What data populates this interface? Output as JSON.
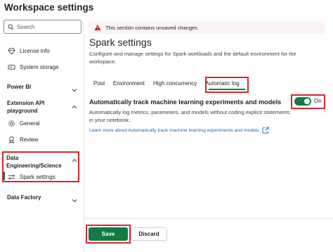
{
  "window": {
    "title": "Workspace settings"
  },
  "search": {
    "placeholder": "Search"
  },
  "sidebar": {
    "items": [
      {
        "label": "License info"
      },
      {
        "label": "System storage"
      }
    ],
    "power_bi": {
      "label": "Power BI"
    },
    "extension_api": {
      "label_line1": "Extension API",
      "label_line2": "playground",
      "items": [
        {
          "label": "General"
        },
        {
          "label": "Review"
        }
      ]
    },
    "data_engineering": {
      "label_line1": "Data",
      "label_line2": "Engineering/Science",
      "items": [
        {
          "label": "Spark settings"
        }
      ]
    },
    "data_factory": {
      "label": "Data Factory"
    }
  },
  "warning": {
    "text": "This section contains unsaved changes."
  },
  "main": {
    "title": "Spark settings",
    "description": "Configure and manage settings for Spark workloads and the default environment for the workspace.",
    "tabs": [
      {
        "label": "Pool"
      },
      {
        "label": "Environment"
      },
      {
        "label": "High concurrency"
      },
      {
        "label": "Automatic log"
      }
    ],
    "active_tab": "Automatic log",
    "setting": {
      "title": "Automatically track machine learning experiments and models",
      "description": "Automatically log metrics, parameters, and models without coding explicit statements in your notebook.",
      "link": "Learn more about Automatically track machine learning experiments and models",
      "toggle_state": "On",
      "toggle_on": true
    }
  },
  "footer": {
    "save_label": "Save",
    "discard_label": "Discard"
  },
  "colors": {
    "accent": "#107c41",
    "highlight": "#d6262e",
    "link": "#0f6cbd",
    "warning_bg": "#fdf3f4",
    "warning_icon": "#c50f1f"
  }
}
